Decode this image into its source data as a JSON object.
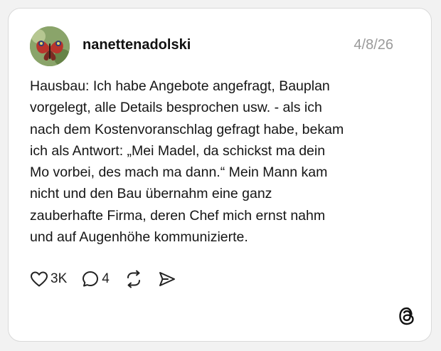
{
  "post": {
    "username": "nanettenadolski",
    "date": "4/8/26",
    "text_lines": [
      "Hausbau: Ich habe Angebote angefragt, Bauplan",
      "vorgelegt, alle Details besprochen usw. - als ich",
      "nach dem Kostenvoranschlag gefragt habe, bekam",
      "ich als Antwort: „Mei Madel, da schickst ma dein",
      "Mo vorbei, des mach ma dann.“ Mein Mann kam",
      "nicht und den Bau übernahm eine ganz",
      "zauberhafte Firma, deren Chef mich ernst nahm",
      "und auf Augenhöhe kommunizierte."
    ]
  },
  "actions": {
    "like": {
      "icon": "heart-icon",
      "count": "3K"
    },
    "reply": {
      "icon": "comment-icon",
      "count": "4"
    },
    "repost": {
      "icon": "repost-icon"
    },
    "share": {
      "icon": "send-icon"
    }
  },
  "branding": {
    "icon": "threads-logo-icon"
  },
  "colors": {
    "background": "#f2f2f2",
    "card": "#ffffff",
    "text": "#151515",
    "muted": "#9a9a9a"
  }
}
